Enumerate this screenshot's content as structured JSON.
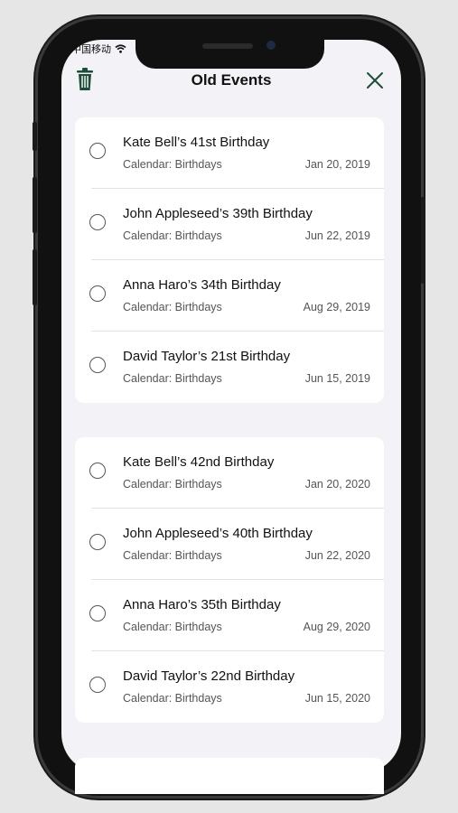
{
  "status": {
    "carrier": "中国移动",
    "wifi_icon": "wifi-icon"
  },
  "header": {
    "title": "Old Events",
    "trash_icon": "trash-icon",
    "close_icon": "close-icon"
  },
  "colors": {
    "accent": "#1e4d3a",
    "background": "#f2f2f7"
  },
  "groups": [
    {
      "events": [
        {
          "name": "Kate Bell’s 41st Birthday",
          "calendar": "Calendar: Birthdays",
          "date": "Jan 20, 2019"
        },
        {
          "name": "John Appleseed’s 39th Birthday",
          "calendar": "Calendar: Birthdays",
          "date": "Jun 22, 2019"
        },
        {
          "name": "Anna Haro’s 34th Birthday",
          "calendar": "Calendar: Birthdays",
          "date": "Aug 29, 2019"
        },
        {
          "name": "David Taylor’s 21st Birthday",
          "calendar": "Calendar: Birthdays",
          "date": "Jun 15, 2019"
        }
      ]
    },
    {
      "events": [
        {
          "name": "Kate Bell’s 42nd Birthday",
          "calendar": "Calendar: Birthdays",
          "date": "Jan 20, 2020"
        },
        {
          "name": "John Appleseed’s 40th Birthday",
          "calendar": "Calendar: Birthdays",
          "date": "Jun 22, 2020"
        },
        {
          "name": "Anna Haro’s 35th Birthday",
          "calendar": "Calendar: Birthdays",
          "date": "Aug 29, 2020"
        },
        {
          "name": "David Taylor’s 22nd Birthday",
          "calendar": "Calendar: Birthdays",
          "date": "Jun 15, 2020"
        }
      ]
    }
  ]
}
